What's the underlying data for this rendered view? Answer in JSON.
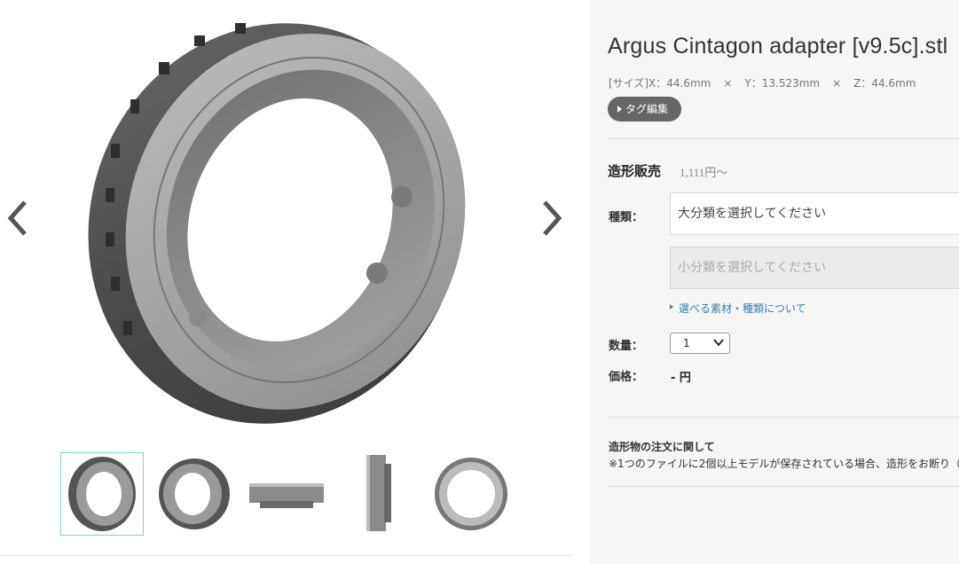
{
  "product": {
    "title": "Argus Cintagon adapter [v9.5c].stl",
    "size": {
      "label": "[サイズ]",
      "x": "X：44.6mm",
      "y": "Y：13.523mm",
      "z": "Z：44.6mm",
      "sep": "×"
    },
    "tag_button": "タグ編集"
  },
  "viewer": {
    "prev_icon": "chevron-left-icon",
    "next_icon": "chevron-right-icon",
    "thumbnail_count": 5,
    "selected_thumbnail": 1
  },
  "order": {
    "sale_label": "造形販売",
    "sale_price": "1,111円〜",
    "type_label": "種類：",
    "category_placeholder": "大分類を選択してください",
    "subcategory_placeholder": "小分類を選択してください",
    "materials_link": "選べる素材・種類について",
    "quantity_label": "数量：",
    "quantity_value": "1",
    "price_label": "価格：",
    "price_value": "- 円"
  },
  "notice": {
    "title": "造形物の注文に関して",
    "text": "※1つのファイルに2個以上モデルが保存されている場合、造形をお断り（"
  },
  "colors": {
    "panel_bg": "#f6f6f6",
    "tag_button_bg": "#666666",
    "link": "#3a7fa8",
    "thumb_active_border": "#7fd0d8"
  }
}
